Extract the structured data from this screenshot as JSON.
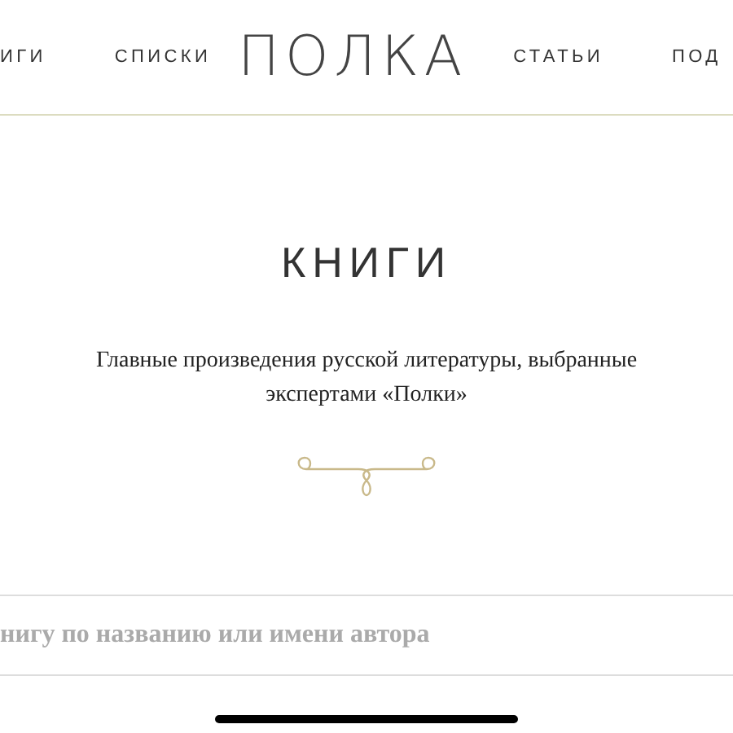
{
  "nav": {
    "left_items": [
      "ИГИ",
      "СПИСКИ"
    ],
    "logo": "ПОЛКА",
    "right_items": [
      "СТАТЬИ",
      "ПОД"
    ]
  },
  "title": "КНИГИ",
  "description": "Главные произведения русской литературы, выбранные экспертами «Полки»",
  "search": {
    "placeholder": "нигу по названию или имени автора"
  }
}
